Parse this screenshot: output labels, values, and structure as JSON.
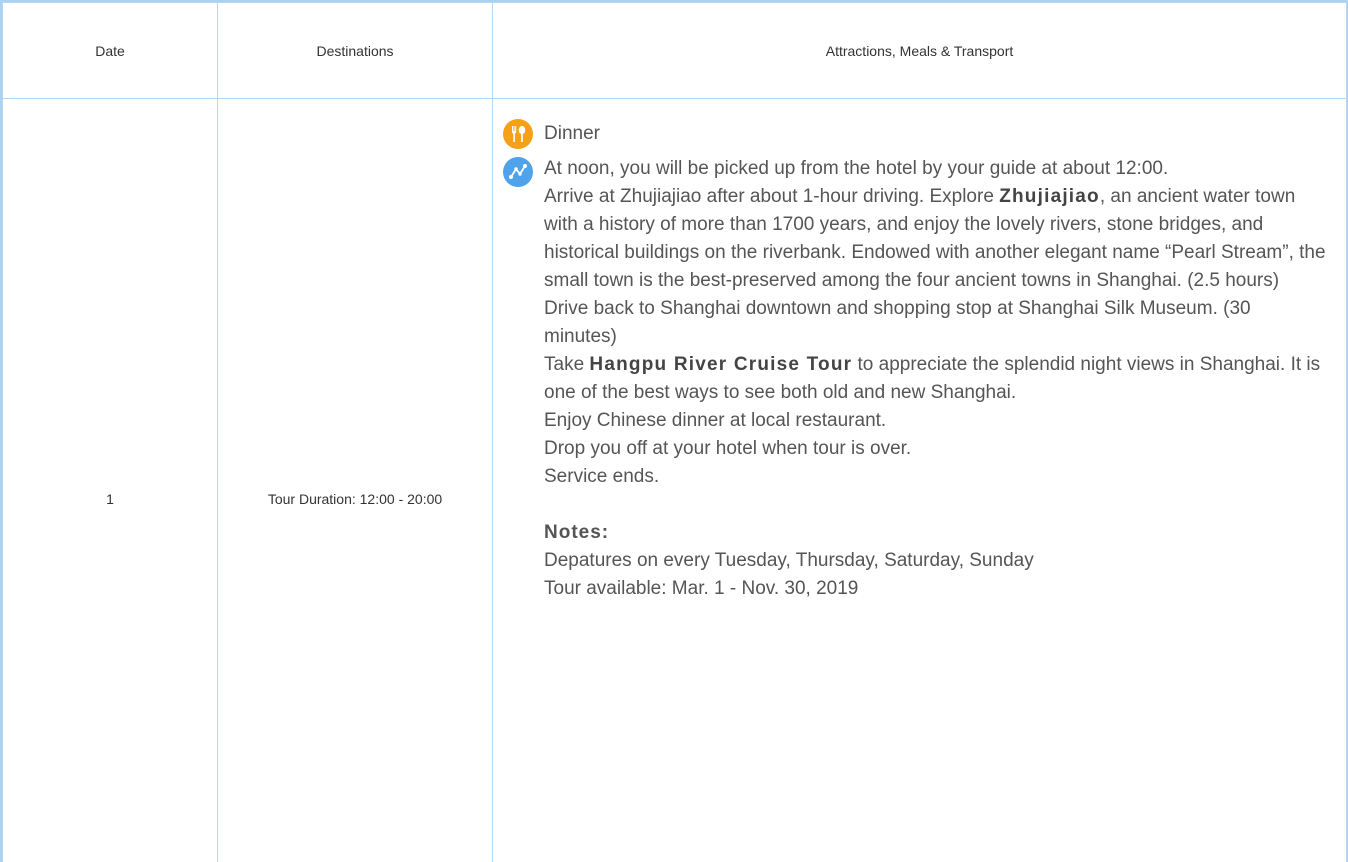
{
  "table": {
    "headers": [
      "Date",
      "Destinations",
      "Attractions, Meals & Transport"
    ],
    "day": "1",
    "destination": "Tour Duration: 12:00 - 20:00",
    "meal": "Dinner",
    "itinerary": {
      "p1": "At noon, you will be picked up from the hotel by your guide at about 12:00.",
      "p2_pre": "Arrive at Zhujiajiao after about 1-hour driving. Explore ",
      "p2_strong": "Zhujiajiao",
      "p2_post": ", an ancient water town with a history of more than 1700 years, and enjoy the lovely rivers, stone bridges, and historical buildings on the riverbank. Endowed with another elegant name “Pearl Stream”, the small town is the best-preserved among the four ancient towns in Shanghai. (2.5 hours)",
      "p3": "Drive back to Shanghai downtown and shopping stop at Shanghai Silk Museum. (30 minutes)",
      "p4_pre": "Take ",
      "p4_strong": "Hangpu River Cruise Tour",
      "p4_post": " to appreciate the splendid night views in Shanghai. It is one of the best ways to see both old and new Shanghai.",
      "p5": "Enjoy Chinese dinner at local restaurant.",
      "p6": "Drop you off at your hotel when tour is over.",
      "p7": "Service ends."
    },
    "notes": {
      "title": "Notes:",
      "line1": "Depatures on every Tuesday, Thursday, Saturday, Sunday",
      "line2": "Tour available: Mar. 1 - Nov. 30, 2019"
    }
  },
  "icons": {
    "meal": "fork-spoon-icon",
    "route": "route-icon",
    "meal_color": "#f4a118",
    "route_color": "#4fa3ea"
  }
}
